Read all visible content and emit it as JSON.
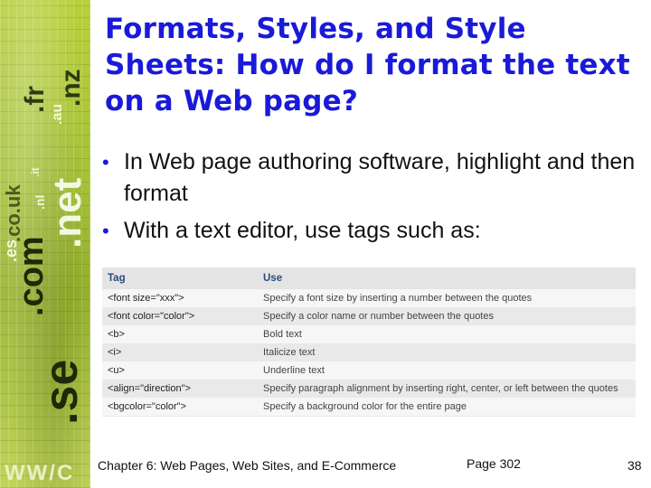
{
  "title": "Formats, Styles, and Style Sheets: How do I format the text on a Web page?",
  "bullets": [
    "In Web page authoring software, highlight and then format",
    "With a text editor, use tags such as:"
  ],
  "bullet_glyph": "•",
  "table": {
    "headers": [
      "Tag",
      "Use"
    ],
    "rows": [
      [
        "<font size=\"xxx\">",
        "Specify a font size by inserting a number between the quotes"
      ],
      [
        "<font color=\"color\">",
        "Specify a color name or number between the quotes"
      ],
      [
        "<b>",
        "Bold text"
      ],
      [
        "<i>",
        "Italicize text"
      ],
      [
        "<u>",
        "Underline text"
      ],
      [
        "<align=\"direction\">",
        "Specify paragraph alignment by inserting right, center, or left between the quotes"
      ],
      [
        "<bgcolor=\"color\">",
        "Specify a background color for the entire page"
      ]
    ]
  },
  "footer": {
    "chapter": "Chapter 6: Web Pages, Web Sites, and E-Commerce",
    "page": "Page 302",
    "slide_number": "38"
  },
  "side_domains": {
    "fr": ".fr",
    "nz": ".nz",
    "au": ".au",
    "uk": ".co.uk",
    "nl": ".nl",
    "it": ".it",
    "net": ".net",
    "es": ".es",
    "com": ".com",
    "se": ".se",
    "bottom": "WW/C"
  },
  "colors": {
    "title": "#1a1ad9",
    "bullet": "#1a1ad9",
    "table_header": "#2a4a7a",
    "strip": "#a7c23a"
  }
}
